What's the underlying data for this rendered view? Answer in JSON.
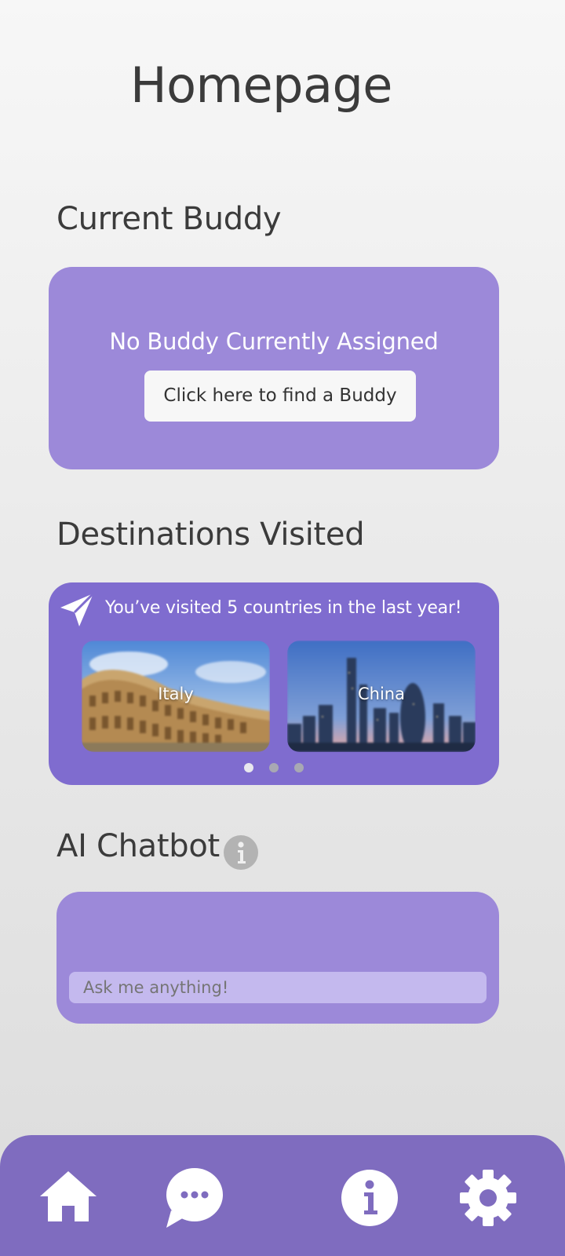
{
  "page": {
    "title": "Homepage"
  },
  "buddy": {
    "section_title": "Current Buddy",
    "message": "No Buddy Currently Assigned",
    "button_label": "Click here to find a Buddy"
  },
  "destinations": {
    "section_title": "Destinations Visited",
    "summary": "You’ve visited 5 countries in the last year!",
    "icon": "paper-plane-icon",
    "items": [
      {
        "label": "Italy"
      },
      {
        "label": "China"
      }
    ],
    "pagination": {
      "total": 3,
      "active": 1
    }
  },
  "chatbot": {
    "section_title": "AI Chatbot",
    "info_icon": "info-icon",
    "input_placeholder": "Ask me anything!"
  },
  "nav": {
    "items": [
      {
        "icon": "home-icon"
      },
      {
        "icon": "chat-bubble-icon"
      },
      {
        "icon": "info-icon"
      },
      {
        "icon": "gear-icon"
      }
    ]
  },
  "colors": {
    "card_light": "#9c89d9",
    "card_dark": "#7f6ccf",
    "nav_bar": "#7f6cbf",
    "input_bg": "#c4b9ee"
  }
}
